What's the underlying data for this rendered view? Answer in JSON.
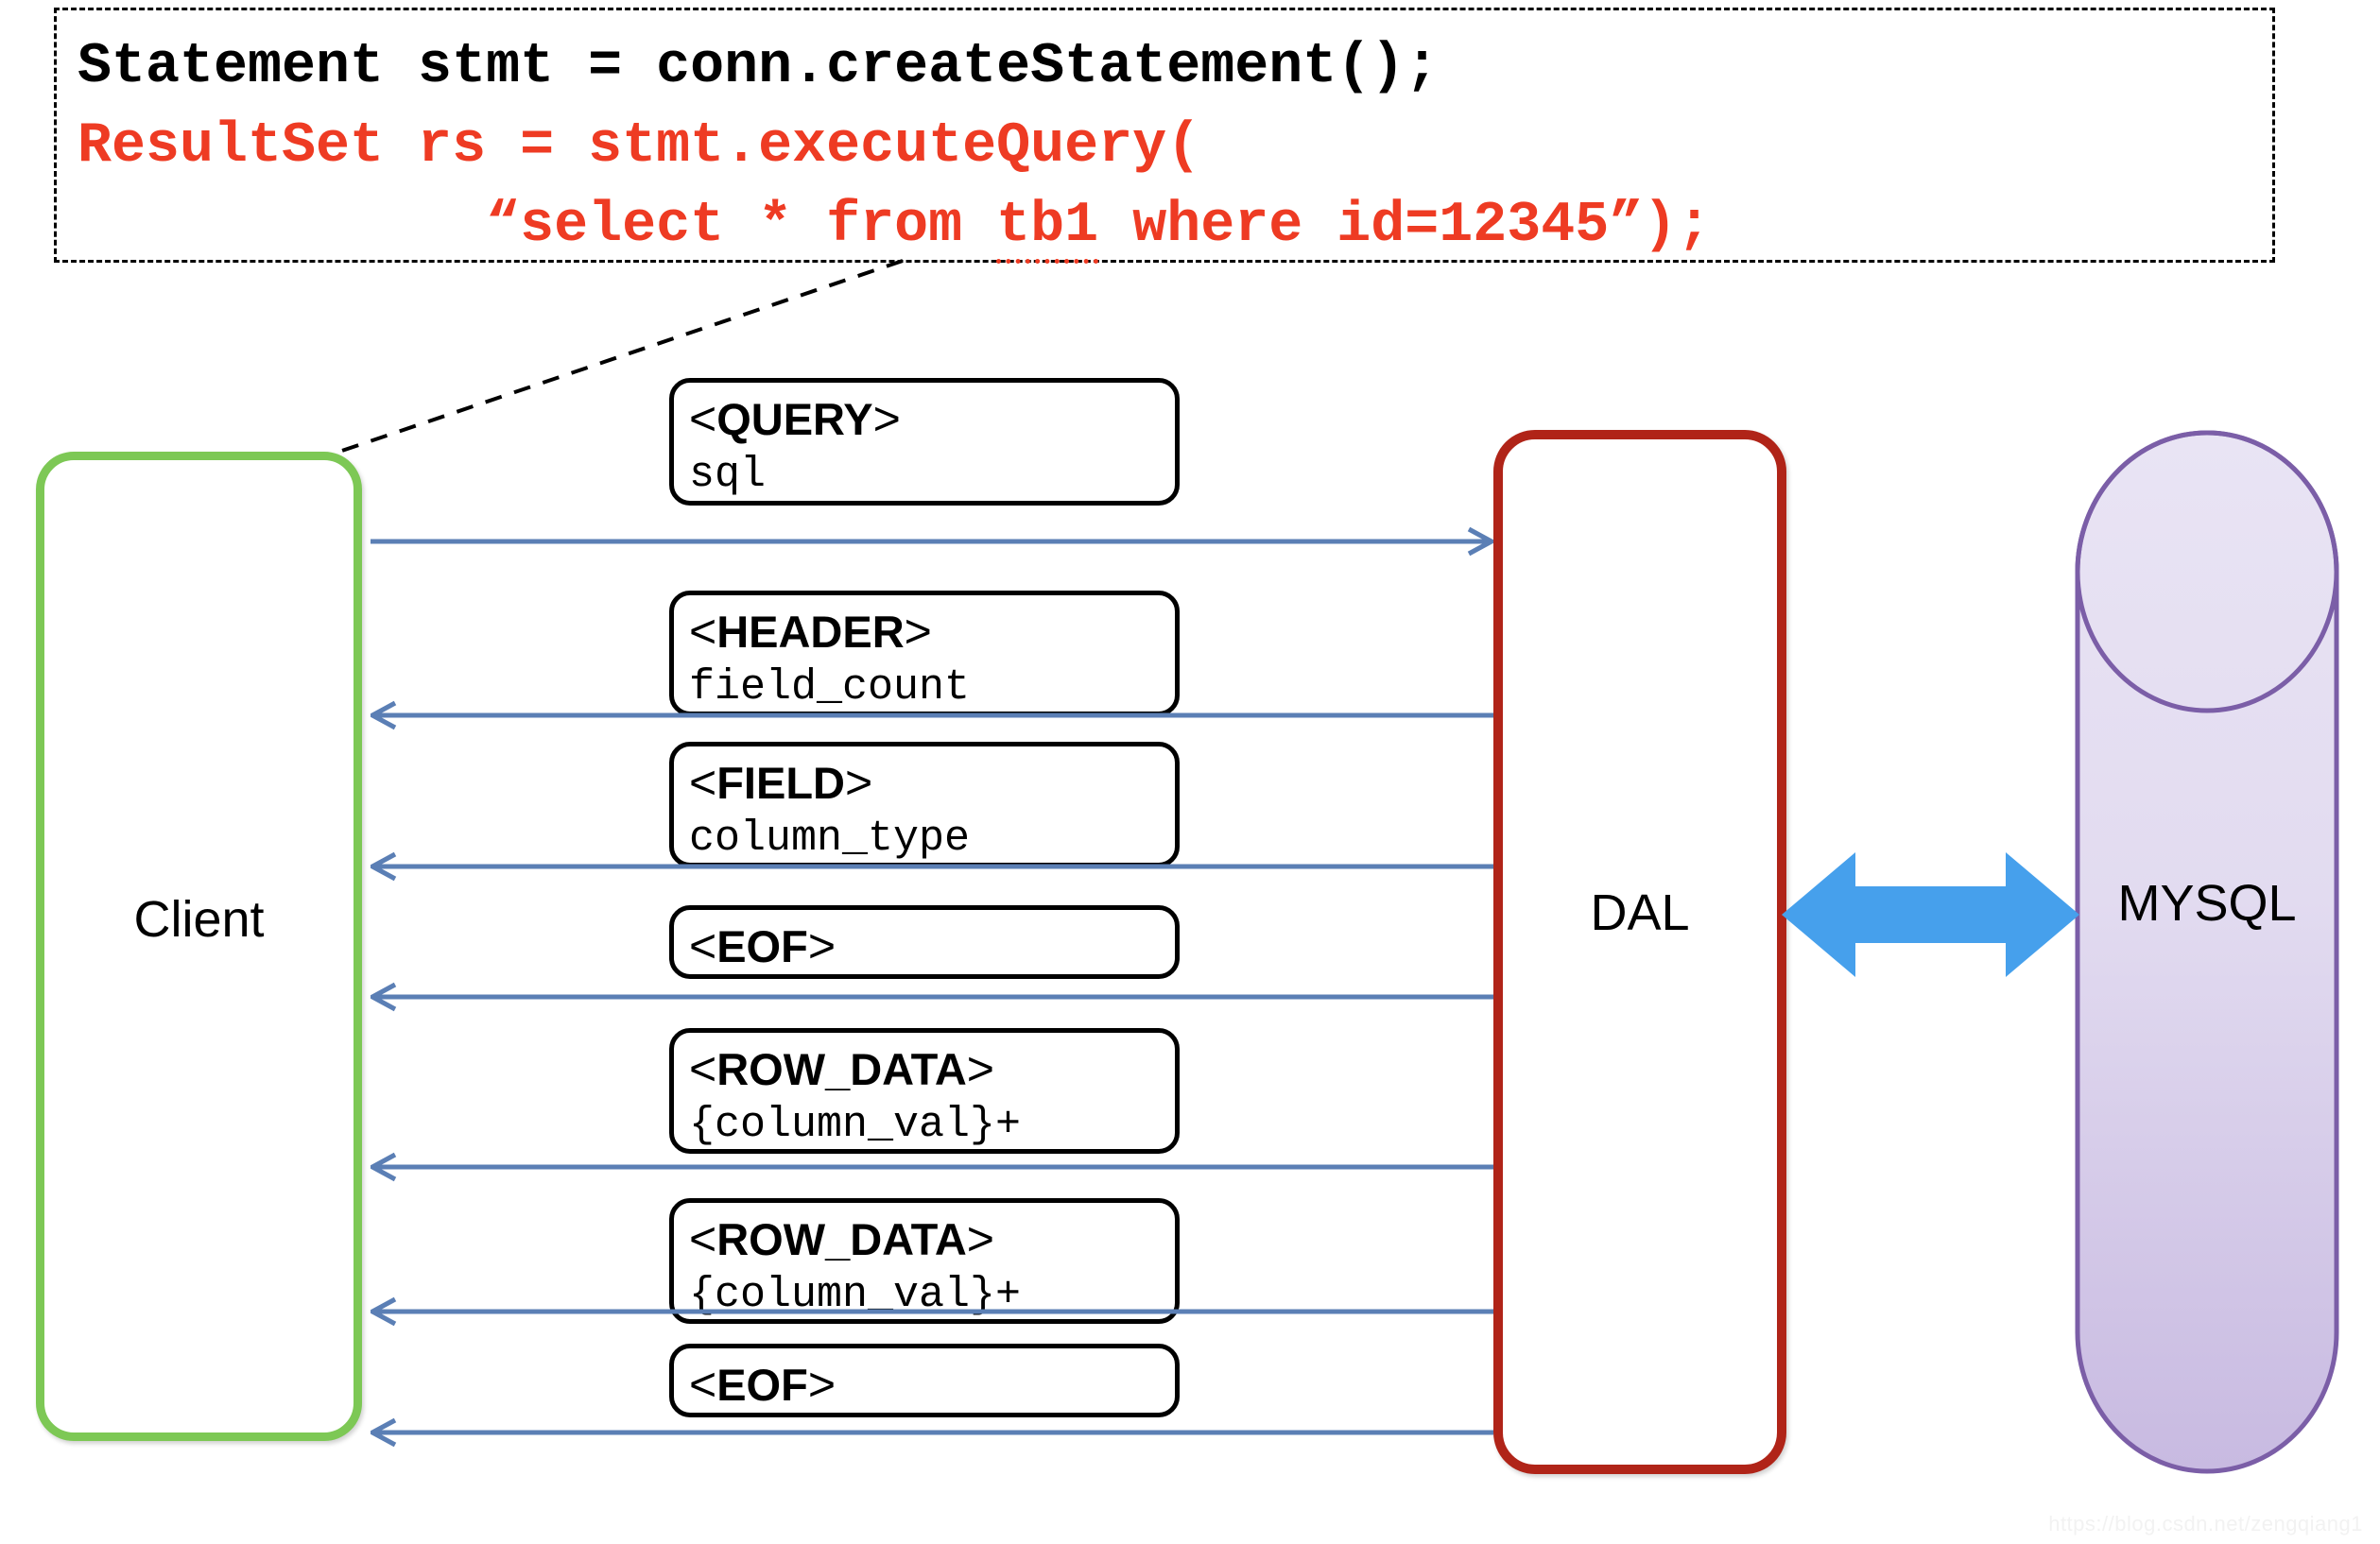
{
  "code_block": {
    "lines": [
      {
        "text": "Statement stmt = conn.createStatement();",
        "color": "black"
      },
      {
        "text": "ResultSet rs = stmt.executeQuery(",
        "color": "red"
      }
    ],
    "sql_line": {
      "indent": "            ",
      "before": "“select * from ",
      "typo": "tb1",
      "after": " where id=12345”);",
      "color": "red"
    }
  },
  "actors": {
    "client": {
      "label": "Client",
      "border_color": "#7DC855"
    },
    "dal": {
      "label": "DAL",
      "border_color": "#B02418"
    },
    "mysql": {
      "label": "MYSQL",
      "border_color": "#7B5EA7",
      "fill_top": "#E7E1F2",
      "fill_bottom": "#CEC2E4"
    }
  },
  "messages": [
    {
      "tag": "QUERY",
      "sub": "sql",
      "direction": "right"
    },
    {
      "tag": "HEADER",
      "sub": "field_count",
      "direction": "left"
    },
    {
      "tag": "FIELD",
      "sub": "column_type",
      "direction": "left"
    },
    {
      "tag": "EOF",
      "sub": "",
      "direction": "left"
    },
    {
      "tag": "ROW_DATA",
      "sub": "{column_val}+",
      "direction": "left"
    },
    {
      "tag": "ROW_DATA",
      "sub": "{column_val}+",
      "direction": "left"
    },
    {
      "tag": "EOF",
      "sub": "",
      "direction": "left"
    }
  ],
  "link_arrow": {
    "name": "dal-mysql-bidirectional",
    "color": "#46A0EC"
  },
  "flow_arrow_color": "#5B7FB5",
  "connector": {
    "style": "dashed",
    "color": "#000000"
  },
  "watermark": {
    "text": "https://blog.csdn.net/zengqiang1"
  }
}
